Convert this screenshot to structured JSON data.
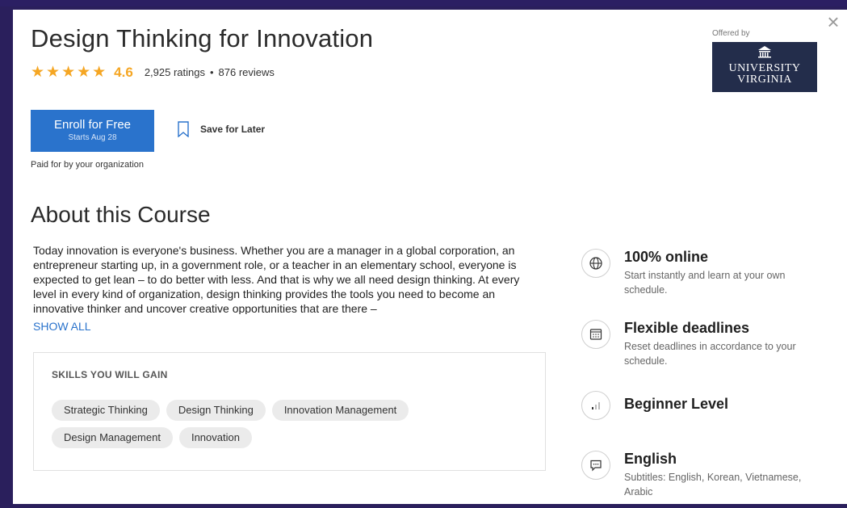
{
  "course": {
    "title": "Design Thinking for Innovation",
    "stars": "★★★★★",
    "rating": "4.6",
    "ratings_count": "2,925 ratings",
    "separator": "•",
    "reviews_count": "876 reviews"
  },
  "offered": {
    "label": "Offered by",
    "logo_line1": "UNIVERSITY",
    "logo_line2": "VIRGINIA"
  },
  "actions": {
    "enroll_label": "Enroll for Free",
    "enroll_sub": "Starts Aug 28",
    "save_label": "Save for Later",
    "paid_note": "Paid for by your organization"
  },
  "about": {
    "heading": "About this Course",
    "description": "Today innovation is everyone's business. Whether you are a manager in a global corporation, an entrepreneur starting up, in a government role, or a teacher in an elementary school, everyone is expected to get lean – to do better with less. And that is why we all need design thinking. At every level in every kind of organization, design thinking provides the tools you need to become an innovative thinker and uncover creative opportunities that are there –",
    "show_all": "SHOW ALL"
  },
  "skills": {
    "title": "SKILLS YOU WILL GAIN",
    "items": [
      "Strategic Thinking",
      "Design Thinking",
      "Innovation Management",
      "Design Management",
      "Innovation"
    ]
  },
  "features": [
    {
      "icon": "globe-icon",
      "title": "100% online",
      "desc": "Start instantly and learn at your own schedule."
    },
    {
      "icon": "calendar-icon",
      "title": "Flexible deadlines",
      "desc": "Reset deadlines in accordance to your schedule."
    },
    {
      "icon": "level-bars-icon",
      "title": "Beginner Level",
      "desc": ""
    },
    {
      "icon": "speech-bubble-icon",
      "title": "English",
      "desc": "Subtitles: English, Korean, Vietnamese, Arabic"
    }
  ],
  "colors": {
    "brand_blue": "#2a73cc",
    "star": "#f5a623",
    "uva_navy": "#232d4b",
    "frame": "#2b1f63"
  }
}
